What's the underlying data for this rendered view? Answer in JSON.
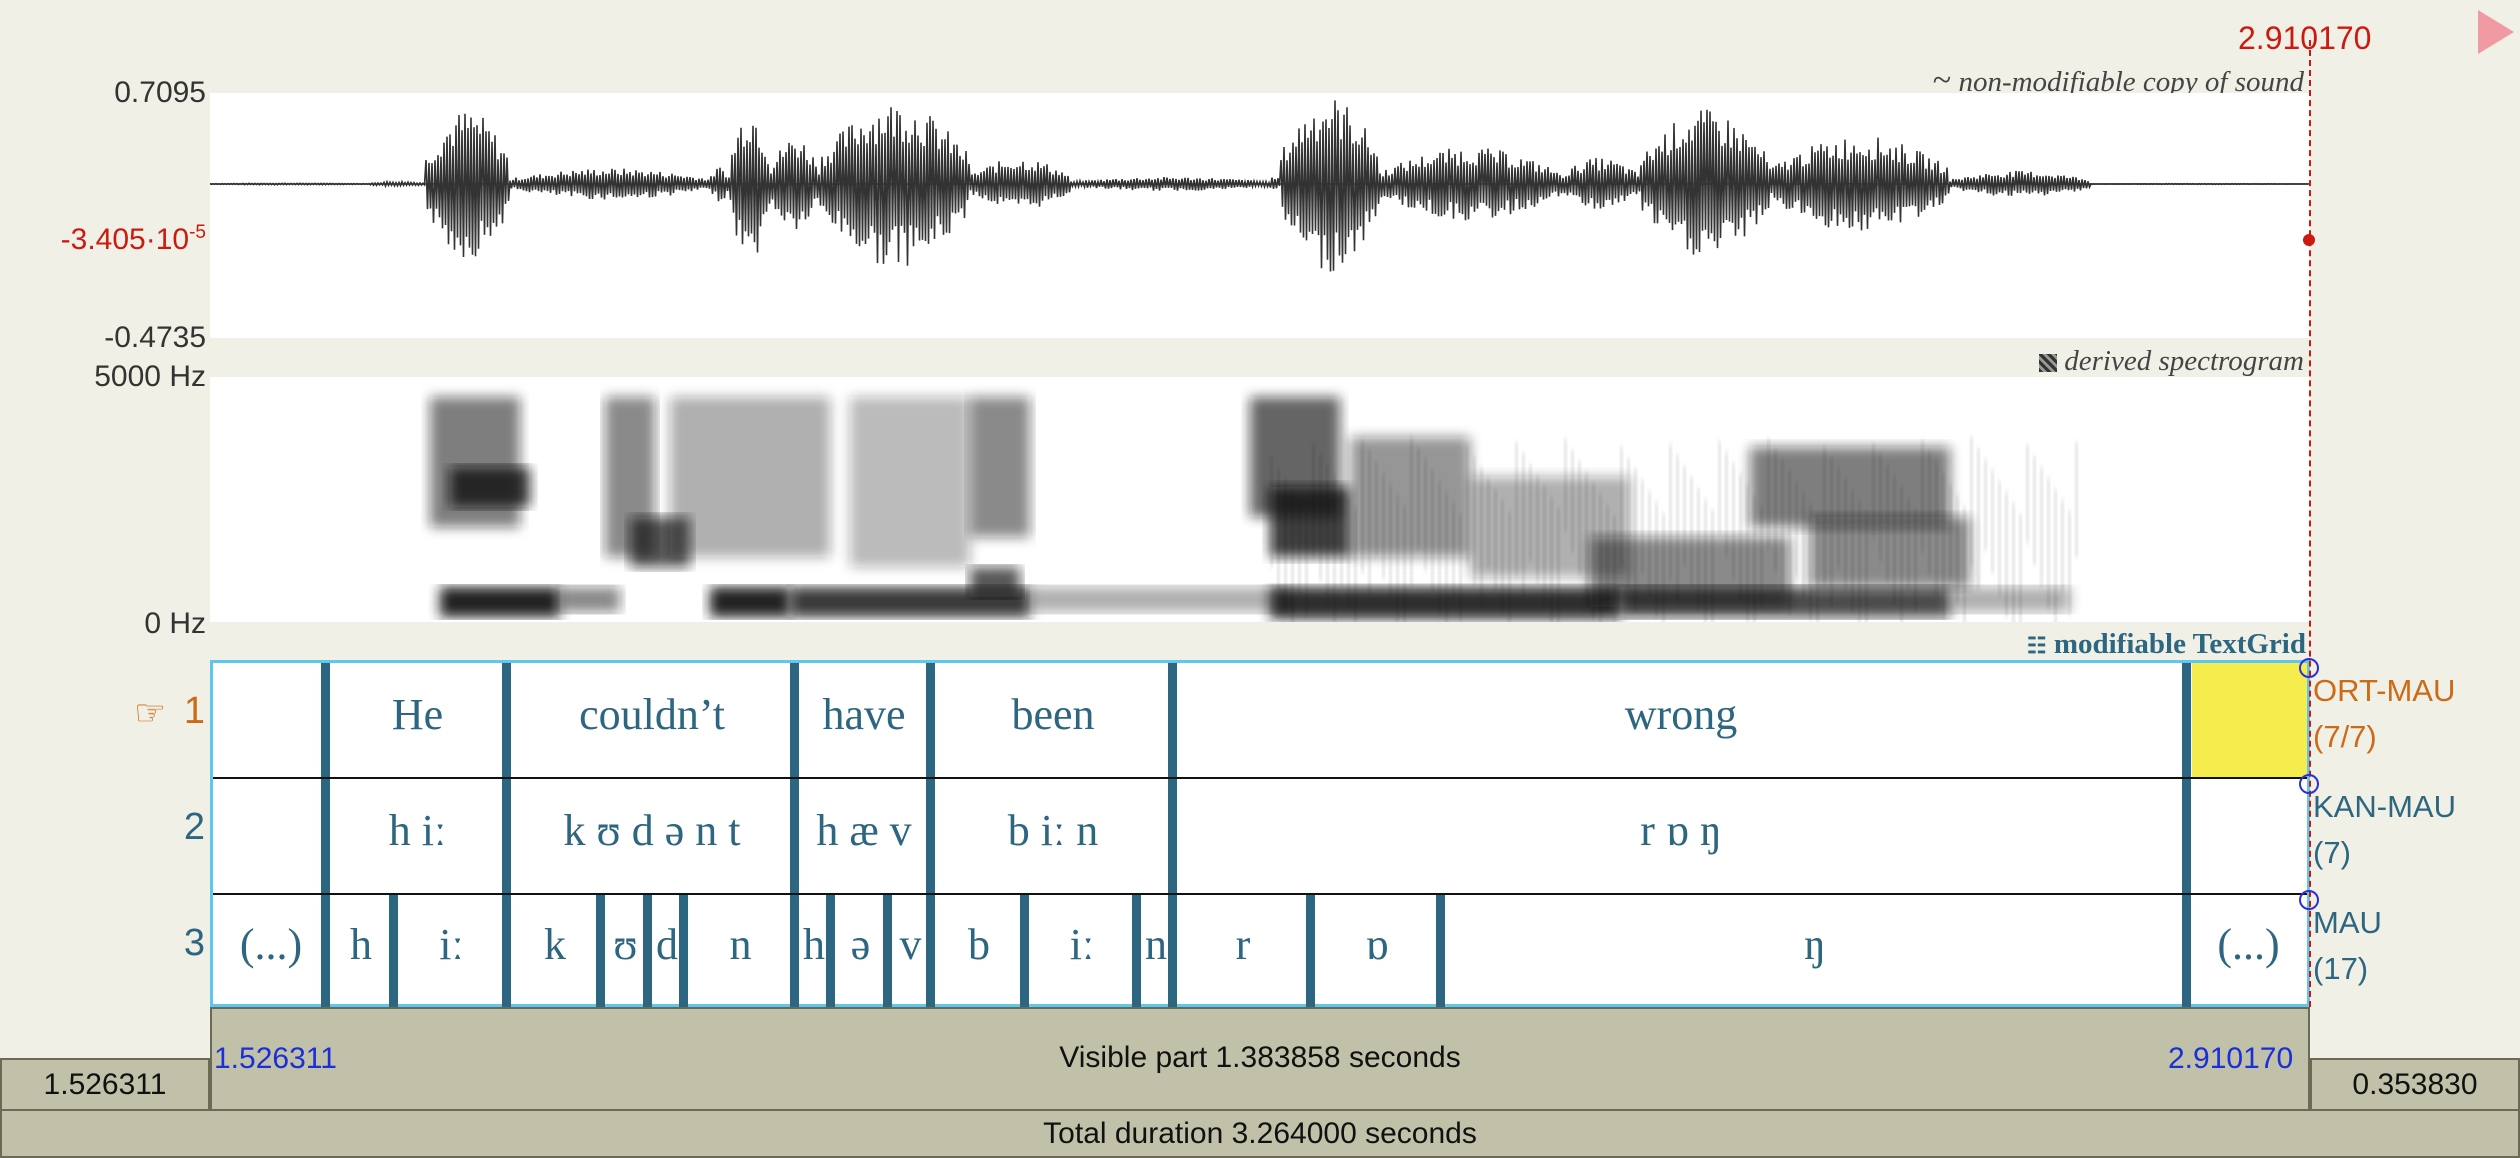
{
  "cursor": {
    "time": "2.910170"
  },
  "waveform": {
    "max_label": "0.7095",
    "cursor_value": "-3.405·10",
    "cursor_exp": "-5",
    "min_label": "-0.4735",
    "title": "non-modifiable copy of sound"
  },
  "spectrogram": {
    "top_label": "5000 Hz",
    "bottom_label": "0 Hz",
    "title": "derived spectrogram"
  },
  "textgrid": {
    "title": "modifiable TextGrid",
    "tiers": [
      {
        "number": "1",
        "name": "ORT-MAU",
        "count": "(7/7)",
        "active": true,
        "segments": [
          {
            "text": "",
            "t0": 1.526311,
            "t1": 1.6
          },
          {
            "text": "He",
            "t0": 1.6,
            "t1": 1.72
          },
          {
            "text": "couldn’t",
            "t0": 1.72,
            "t1": 1.91
          },
          {
            "text": "have",
            "t0": 1.91,
            "t1": 2.0
          },
          {
            "text": "been",
            "t0": 2.0,
            "t1": 2.16
          },
          {
            "text": "wrong",
            "t0": 2.16,
            "t1": 2.83
          },
          {
            "text": "",
            "t0": 2.83,
            "t1": 2.91017,
            "selected": true
          }
        ]
      },
      {
        "number": "2",
        "name": "KAN-MAU",
        "count": "(7)",
        "active": false,
        "segments": [
          {
            "text": "",
            "t0": 1.526311,
            "t1": 1.6
          },
          {
            "text": "h iː",
            "t0": 1.6,
            "t1": 1.72
          },
          {
            "text": "k ʊ d ə n t",
            "t0": 1.72,
            "t1": 1.91
          },
          {
            "text": "h æ v",
            "t0": 1.91,
            "t1": 2.0
          },
          {
            "text": "b iː n",
            "t0": 2.0,
            "t1": 2.16
          },
          {
            "text": "r ɒ ŋ",
            "t0": 2.16,
            "t1": 2.83
          },
          {
            "text": "",
            "t0": 2.83,
            "t1": 2.91017
          }
        ]
      },
      {
        "number": "3",
        "name": "MAU",
        "count": "(17)",
        "active": false,
        "segments": [
          {
            "text": "(...)",
            "t0": 1.526311,
            "t1": 1.6
          },
          {
            "text": "h",
            "t0": 1.6,
            "t1": 1.645
          },
          {
            "text": "iː",
            "t0": 1.645,
            "t1": 1.72
          },
          {
            "text": "k",
            "t0": 1.72,
            "t1": 1.782
          },
          {
            "text": "ʊ",
            "t0": 1.782,
            "t1": 1.813
          },
          {
            "text": "d",
            "t0": 1.813,
            "t1": 1.837
          },
          {
            "text": "n",
            "t0": 1.837,
            "t1": 1.91
          },
          {
            "text": "h",
            "t0": 1.91,
            "t1": 1.934
          },
          {
            "text": "ə",
            "t0": 1.934,
            "t1": 1.972
          },
          {
            "text": "v",
            "t0": 1.972,
            "t1": 2.0
          },
          {
            "text": "b",
            "t0": 2.0,
            "t1": 2.062
          },
          {
            "text": "iː",
            "t0": 2.062,
            "t1": 2.136
          },
          {
            "text": "n",
            "t0": 2.136,
            "t1": 2.16
          },
          {
            "text": "r",
            "t0": 2.16,
            "t1": 2.251
          },
          {
            "text": "ɒ",
            "t0": 2.251,
            "t1": 2.337
          },
          {
            "text": "ŋ",
            "t0": 2.337,
            "t1": 2.83
          },
          {
            "text": "(...)",
            "t0": 2.83,
            "t1": 2.91017
          }
        ]
      }
    ]
  },
  "footer": {
    "left_time": "1.526311",
    "visible_start": "1.526311",
    "visible_label": "Visible part 1.383858 seconds",
    "visible_end": "2.910170",
    "right_time": "0.353830",
    "total_label": "Total duration 3.264000 seconds"
  },
  "colors": {
    "tier_line": "#2c6680",
    "selection": "#f5ec4e",
    "cursor": "#cc1a10",
    "active_tier": "#cc6a18"
  }
}
